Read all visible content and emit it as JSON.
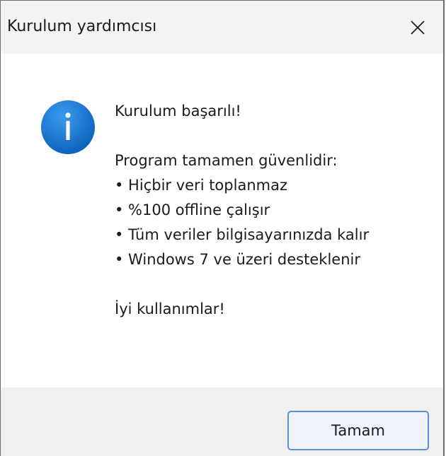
{
  "window": {
    "title": "Kurulum yardımcısı",
    "close_icon": "close-icon"
  },
  "message": {
    "icon": "info-icon",
    "line1": "Kurulum başarılı!",
    "line2": "Program tamamen güvenlidir:",
    "bullets": [
      "• Hiçbir veri toplanmaz",
      "• %100 offline çalışır",
      "• Tüm veriler bilgisayarınızda kalır",
      "• Windows 7 ve üzeri desteklenir"
    ],
    "closing": "İyi kullanımlar!"
  },
  "buttons": {
    "ok_label": "Tamam"
  },
  "colors": {
    "info_icon_fill": "#1677d2",
    "button_border": "#5a8fd0",
    "titlebar_bg": "#f3f3f3",
    "footer_bg": "#f0f0f0"
  }
}
